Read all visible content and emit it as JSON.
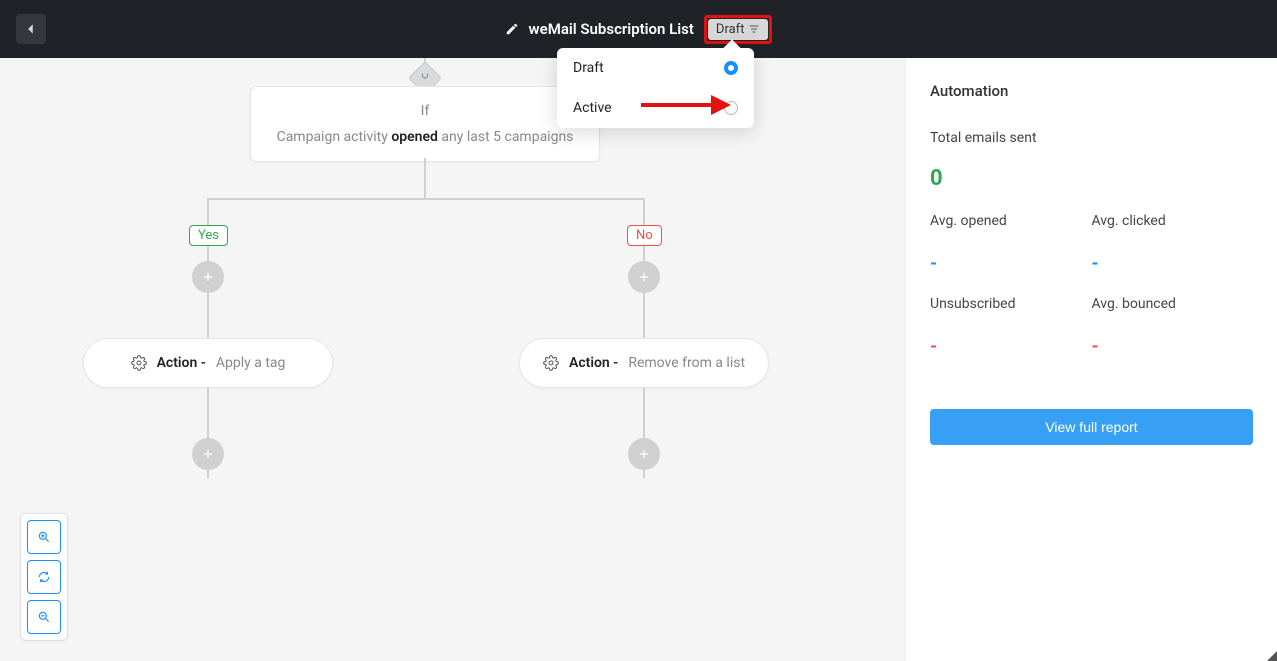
{
  "header": {
    "title": "weMail Subscription List",
    "status_label": "Draft"
  },
  "dropdown": {
    "options": [
      {
        "label": "Draft",
        "selected": true
      },
      {
        "label": "Active",
        "selected": false
      }
    ]
  },
  "flow": {
    "condition": {
      "if_label": "If",
      "prefix": "Campaign activity",
      "bold": "opened",
      "suffix": "any last 5 campaigns"
    },
    "branches": {
      "yes": "Yes",
      "no": "No"
    },
    "action_label": "Action -",
    "yes_action": "Apply a tag",
    "no_action": "Remove from a list"
  },
  "sidebar": {
    "heading": "Automation",
    "total_label": "Total emails sent",
    "total_value": "0",
    "stats": {
      "avg_opened": {
        "label": "Avg. opened",
        "value": "-"
      },
      "avg_clicked": {
        "label": "Avg. clicked",
        "value": "-"
      },
      "unsubscribed": {
        "label": "Unsubscribed",
        "value": "-"
      },
      "avg_bounced": {
        "label": "Avg. bounced",
        "value": "-"
      }
    },
    "report_button": "View full report"
  },
  "icons": {
    "back": "arrow-left",
    "edit": "pencil",
    "filter": "filter",
    "gear": "gear",
    "plus": "plus",
    "zoom_in": "zoom-in",
    "reset": "refresh",
    "zoom_out": "zoom-out"
  },
  "colors": {
    "accent": "#1990ff",
    "success": "#2fa84f",
    "danger": "#f74c4c",
    "header": "#1f2227"
  }
}
